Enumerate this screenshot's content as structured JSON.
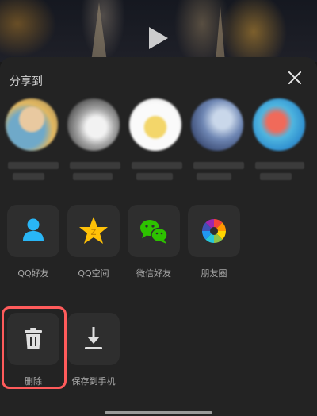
{
  "sheet": {
    "title": "分享到",
    "close_icon": "close-icon"
  },
  "apps": [
    {
      "label": "QQ好友",
      "icon": "qq-friend-icon"
    },
    {
      "label": "QQ空间",
      "icon": "qzone-star-icon"
    },
    {
      "label": "微信好友",
      "icon": "wechat-icon"
    },
    {
      "label": "朋友圈",
      "icon": "moments-aperture-icon"
    }
  ],
  "actions": [
    {
      "label": "删除",
      "icon": "trash-icon"
    },
    {
      "label": "保存到手机",
      "icon": "download-icon"
    }
  ],
  "colors": {
    "sheet_bg": "#232323",
    "tile_bg": "#2e2e2e",
    "highlight": "#ff5b5b",
    "qq_blue": "#29b6f6",
    "qzone_yellow": "#ffc107",
    "wechat_green": "#2dc100"
  }
}
